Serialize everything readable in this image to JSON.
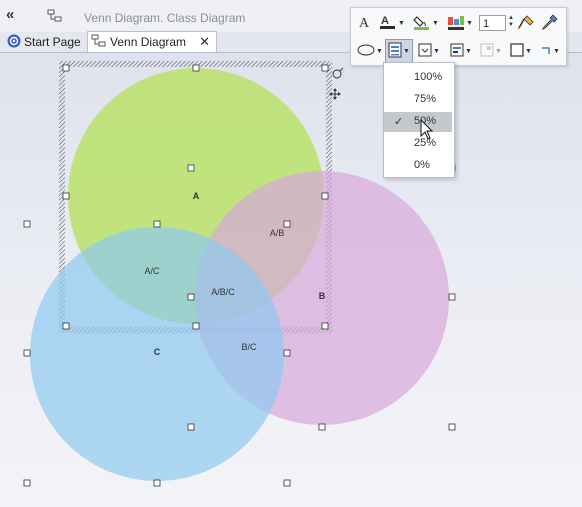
{
  "window": {
    "collapse_label": "«",
    "title": "Venn Diagram.  Class Diagram"
  },
  "tabs": [
    {
      "label": "Start Page"
    },
    {
      "label": "Venn Diagram"
    }
  ],
  "tab_close": "✕",
  "toolbar": {
    "line_width_value": "1"
  },
  "opacity_menu": {
    "options": [
      "100%",
      "75%",
      "50%",
      "25%",
      "0%"
    ],
    "selected": "50%",
    "check_mark": "✓"
  },
  "diagram": {
    "colors": {
      "set_a": "#b9e26a",
      "set_b": "#d8a8dc",
      "set_c": "#8ec9ef"
    },
    "labels": {
      "a": "A",
      "b": "B",
      "c": "C",
      "ab": "A/B",
      "ac": "A/C",
      "bc": "B/C",
      "abc": "A/B/C"
    }
  }
}
